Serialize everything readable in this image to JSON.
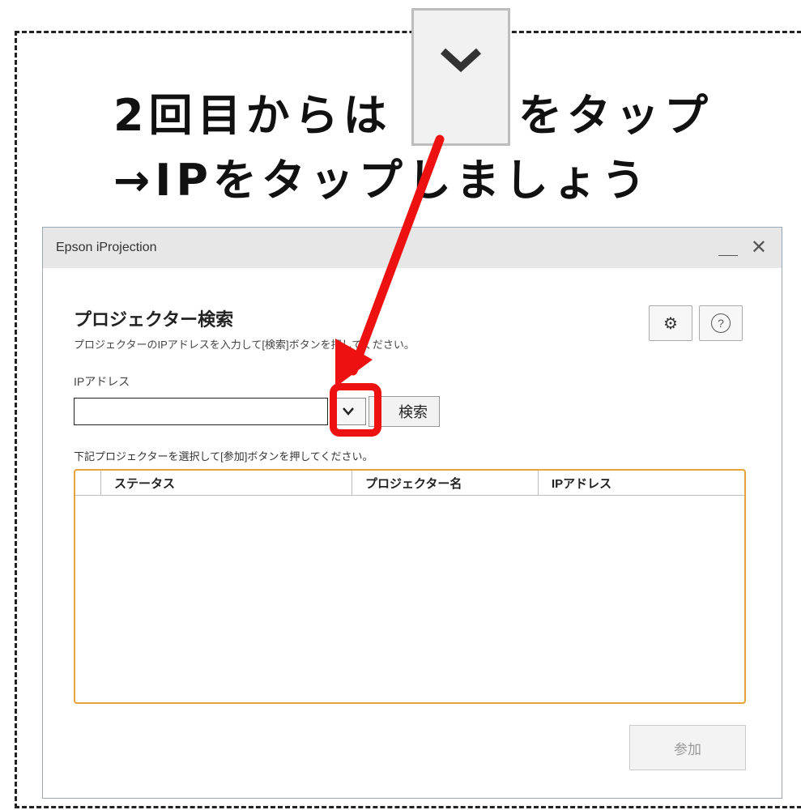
{
  "instruction": {
    "line1_prefix": "2回目からは",
    "line1_suffix": "をタップ",
    "line2": "→IPをタップしましょう"
  },
  "window": {
    "title": "Epson iProjection",
    "minimize_glyph": "＿",
    "close_glyph": "✕"
  },
  "search": {
    "heading": "プロジェクター検索",
    "instructions": "プロジェクターのIPアドレスを入力して[検索]ボタンを押してください。",
    "ip_label": "IPアドレス",
    "ip_value": "",
    "search_button": "検索",
    "settings_glyph": "⚙",
    "help_glyph": "?"
  },
  "list": {
    "instructions": "下記プロジェクターを選択して[参加]ボタンを押してください。",
    "columns": [
      "ステータス",
      "プロジェクター名",
      "IPアドレス"
    ]
  },
  "actions": {
    "join_button": "参加"
  },
  "colors": {
    "highlight": "#ee1111",
    "arrow": "#ee1111",
    "table_border": "#e8a33a"
  },
  "icons": {
    "dropdown": "chevron-down-icon",
    "settings": "gear-icon",
    "help": "help-icon",
    "close": "close-icon",
    "minimize": "minimize-icon"
  }
}
